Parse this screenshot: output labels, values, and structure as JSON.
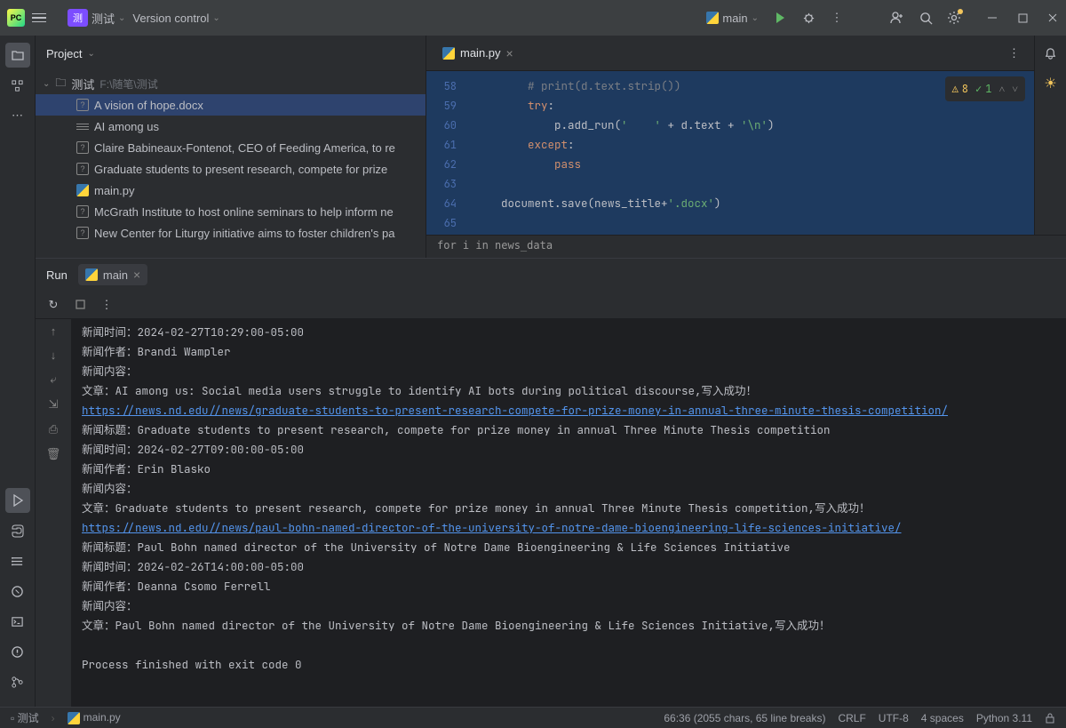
{
  "titlebar": {
    "project_badge": "测",
    "project_name": "测试",
    "vcs_label": "Version control",
    "run_config": "main"
  },
  "project_panel": {
    "title": "Project",
    "root_name": "测试",
    "root_path": "F:\\随笔\\测试",
    "files": [
      "A vision of hope.docx",
      "AI among us",
      "Claire Babineaux-Fontenot, CEO of Feeding America, to re",
      "Graduate students to present research, compete for prize",
      "main.py",
      "McGrath Institute to host online seminars to help inform ne",
      "New Center for Liturgy initiative aims to foster children's pa"
    ]
  },
  "editor": {
    "tab_name": "main.py",
    "line_numbers": [
      "58",
      "59",
      "60",
      "61",
      "62",
      "63",
      "64",
      "65"
    ],
    "warn_count": "8",
    "ok_count": "1",
    "breadcrumb": "for i in news_data",
    "code": {
      "l58": "        # print(d.text.strip())",
      "l59_kw": "try",
      "l60_pre": "            p.add_run(",
      "l60_s1": "'    '",
      "l60_mid": " + d.text + ",
      "l60_s2": "'\\n'",
      "l60_end": ")",
      "l61_kw": "except",
      "l62_kw": "pass",
      "l64_a": "    document.save(news_title+",
      "l64_s": "'.docx'",
      "l64_b": ")"
    }
  },
  "run": {
    "label": "Run",
    "tab": "main",
    "lines": [
      {
        "t": "text",
        "v": "新闻时间：2024-02-27T10:29:00-05:00"
      },
      {
        "t": "text",
        "v": "新闻作者：Brandi Wampler"
      },
      {
        "t": "text",
        "v": "新闻内容："
      },
      {
        "t": "text",
        "v": "文章：AI among us: Social media users struggle to identify AI bots during political discourse,写入成功！"
      },
      {
        "t": "link",
        "v": "https://news.nd.edu//news/graduate-students-to-present-research-compete-for-prize-money-in-annual-three-minute-thesis-competition/"
      },
      {
        "t": "text",
        "v": "新闻标题：Graduate students to present research, compete for prize money in annual Three Minute Thesis competition"
      },
      {
        "t": "text",
        "v": "新闻时间：2024-02-27T09:00:00-05:00"
      },
      {
        "t": "text",
        "v": "新闻作者：Erin Blasko"
      },
      {
        "t": "text",
        "v": "新闻内容："
      },
      {
        "t": "text",
        "v": "文章：Graduate students to present research, compete for prize money in annual Three Minute Thesis competition,写入成功！"
      },
      {
        "t": "link",
        "v": "https://news.nd.edu//news/paul-bohn-named-director-of-the-university-of-notre-dame-bioengineering-life-sciences-initiative/"
      },
      {
        "t": "text",
        "v": "新闻标题：Paul Bohn named director of the University of Notre Dame Bioengineering & Life Sciences Initiative"
      },
      {
        "t": "text",
        "v": "新闻时间：2024-02-26T14:00:00-05:00"
      },
      {
        "t": "text",
        "v": "新闻作者：Deanna Csomo Ferrell"
      },
      {
        "t": "text",
        "v": "新闻内容："
      },
      {
        "t": "text",
        "v": "文章：Paul Bohn named director of the University of Notre Dame Bioengineering & Life Sciences Initiative,写入成功！"
      },
      {
        "t": "text",
        "v": ""
      },
      {
        "t": "text",
        "v": "Process finished with exit code 0"
      }
    ]
  },
  "status": {
    "breadcrumb_proj": "测试",
    "breadcrumb_file": "main.py",
    "pos": "66:36 (2055 chars, 65 line breaks)",
    "eol": "CRLF",
    "encoding": "UTF-8",
    "indent": "4 spaces",
    "interpreter": "Python 3.11"
  }
}
